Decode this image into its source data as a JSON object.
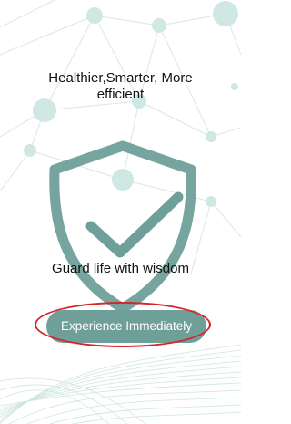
{
  "screen": {
    "headline": "Healthier,Smarter, More efficient",
    "tagline": "Guard life with wisdom",
    "cta_label": "Experience Immediately"
  },
  "icons": {
    "hero": "shield-check-icon"
  },
  "colors": {
    "accent": "#6f9f99",
    "shield": "#6f9f99",
    "network_node": "#cfe8e3",
    "network_line": "#d8e8e5",
    "highlight": "#d8242b",
    "text": "#111111",
    "button_text": "#ffffff"
  }
}
